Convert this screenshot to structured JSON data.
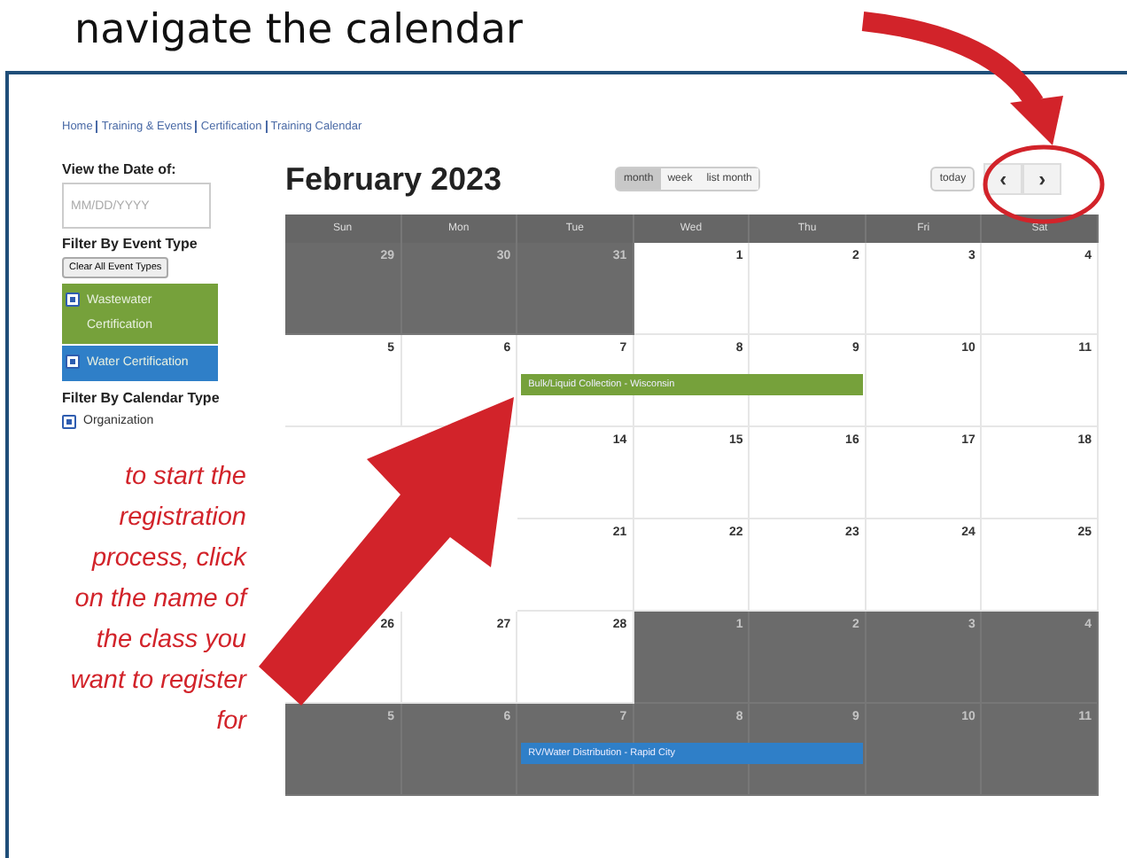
{
  "annotation_title": "navigate the calendar",
  "breadcrumb": [
    "Home",
    "Training & Events",
    "Certification",
    "Training Calendar"
  ],
  "sidebar": {
    "date_label": "View the Date of:",
    "date_field": {
      "placeholder": "MM/DD/YYYY"
    },
    "event_filter_heading": "Filter By Event Type",
    "clear_button": "Clear All Event Types",
    "event_types": [
      {
        "label": "Wastewater Certification",
        "checked": true,
        "color": "#76a13b"
      },
      {
        "label": "Water Certification",
        "checked": true,
        "color": "#2f7fc8"
      }
    ],
    "calendar_type_heading": "Filter By Calendar Type",
    "calendar_types": [
      {
        "label": "Organization",
        "checked": true
      }
    ]
  },
  "instruction": "to start the registration process, click on the name of the class you want to register for",
  "calendar": {
    "title": "February 2023",
    "view_buttons": [
      {
        "label": "month",
        "selected": true
      },
      {
        "label": "week",
        "selected": false
      },
      {
        "label": "list month",
        "selected": false
      }
    ],
    "today_button": "today",
    "prev_button": "‹",
    "next_button": "›",
    "weekdays": [
      "Sun",
      "Mon",
      "Tue",
      "Wed",
      "Thu",
      "Fri",
      "Sat"
    ],
    "weeks": [
      {
        "days": [
          {
            "day": "29",
            "other_month": true
          },
          {
            "day": "30",
            "other_month": true
          },
          {
            "day": "31",
            "other_month": true
          },
          {
            "day": "1",
            "other_month": false
          },
          {
            "day": "2",
            "other_month": false
          },
          {
            "day": "3",
            "other_month": false
          },
          {
            "day": "4",
            "other_month": false
          }
        ]
      },
      {
        "days": [
          {
            "day": "5",
            "other_month": false
          },
          {
            "day": "6",
            "other_month": false
          },
          {
            "day": "7",
            "other_month": false,
            "event": {
              "title": "Bulk/Liquid Collection - Wisconsin",
              "color": "#76a13b"
            }
          },
          {
            "day": "8",
            "other_month": false,
            "event_continues": true
          },
          {
            "day": "9",
            "other_month": false,
            "event_continues": true
          },
          {
            "day": "10",
            "other_month": false
          },
          {
            "day": "11",
            "other_month": false
          }
        ]
      },
      {
        "days": [
          {
            "day": "14",
            "other_month": false
          },
          {
            "day": "15",
            "other_month": false
          },
          {
            "day": "16",
            "other_month": false
          },
          {
            "day": "17",
            "other_month": false
          },
          {
            "day": "18",
            "other_month": false
          }
        ]
      },
      {
        "days": [
          {
            "day": "21",
            "other_month": false
          },
          {
            "day": "22",
            "other_month": false
          },
          {
            "day": "23",
            "other_month": false
          },
          {
            "day": "24",
            "other_month": false
          },
          {
            "day": "25",
            "other_month": false
          }
        ]
      },
      {
        "days": [
          {
            "day": "26",
            "other_month": false
          },
          {
            "day": "27",
            "other_month": false
          },
          {
            "day": "28",
            "other_month": false
          },
          {
            "day": "1",
            "other_month": true
          },
          {
            "day": "2",
            "other_month": true
          },
          {
            "day": "3",
            "other_month": true
          },
          {
            "day": "4",
            "other_month": true
          }
        ]
      },
      {
        "days": [
          {
            "day": "5",
            "other_month": true
          },
          {
            "day": "6",
            "other_month": true
          },
          {
            "day": "7",
            "other_month": true,
            "event": {
              "title": "RV/Water Distribution - Rapid City",
              "color": "#2f7fc8"
            }
          },
          {
            "day": "8",
            "other_month": true,
            "event_continues": true
          },
          {
            "day": "9",
            "other_month": true,
            "event_continues": true
          },
          {
            "day": "10",
            "other_month": true
          },
          {
            "day": "11",
            "other_month": true
          }
        ]
      }
    ]
  }
}
